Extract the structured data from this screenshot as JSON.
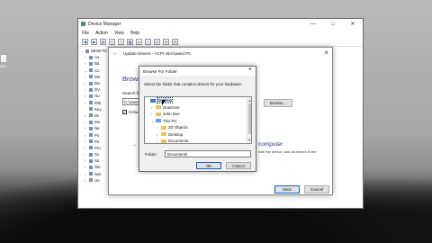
{
  "device_manager": {
    "title": "Device Manager",
    "menu": [
      "File",
      "Action",
      "View",
      "Help"
    ],
    "window_controls": {
      "minimize": "—",
      "maximize": "□",
      "close": "✕"
    },
    "tree": [
      {
        "label": "DESKTO",
        "expanded": true
      },
      {
        "label": "Au"
      },
      {
        "label": "Ba"
      },
      {
        "label": "Co",
        "expanded": true
      },
      {
        "label": "Dis"
      },
      {
        "label": "Dis"
      },
      {
        "label": "DV"
      },
      {
        "label": "Hu"
      },
      {
        "label": "IDE"
      },
      {
        "label": "Key"
      },
      {
        "label": "Mi"
      },
      {
        "label": "Mo"
      },
      {
        "label": "Ne"
      },
      {
        "label": "Po"
      },
      {
        "label": "Pri"
      },
      {
        "label": "Pro"
      },
      {
        "label": "So"
      },
      {
        "label": "So"
      },
      {
        "label": "Sto"
      },
      {
        "label": "Sys"
      },
      {
        "label": "Un"
      }
    ]
  },
  "desktop_icon_label": "000",
  "update_drivers": {
    "title": "Update Drivers - ACPI x64-based PC",
    "heading": "Browse",
    "search_label": "Search fo",
    "path_value": "C:\\Users",
    "include_label": "Include",
    "browse_button": "Browse...",
    "pick_link": "computer",
    "pick_desc": "with the device, and all drivers in the",
    "next_button": "Next",
    "cancel_button": "Cancel",
    "arrow": "→ Le"
  },
  "browse_for_folder": {
    "title": "Browse For Folder",
    "instruction": "Select the folder that contains drivers for your hardware.",
    "tree": [
      {
        "label": "Desktop",
        "level": 0,
        "expander": "",
        "selected": true
      },
      {
        "label": "OneDrive",
        "level": 1,
        "expander": ">"
      },
      {
        "label": "John Doe",
        "level": 1,
        "expander": ">"
      },
      {
        "label": "This PC",
        "level": 1,
        "expander": "v"
      },
      {
        "label": "3D Objects",
        "level": 2,
        "expander": ">"
      },
      {
        "label": "Desktop",
        "level": 2,
        "expander": ">"
      },
      {
        "label": "Documents",
        "level": 2,
        "expander": ">"
      }
    ],
    "folder_label": "Folder:",
    "folder_value": "Documents",
    "ok_button": "OK",
    "cancel_button": "Cancel"
  }
}
